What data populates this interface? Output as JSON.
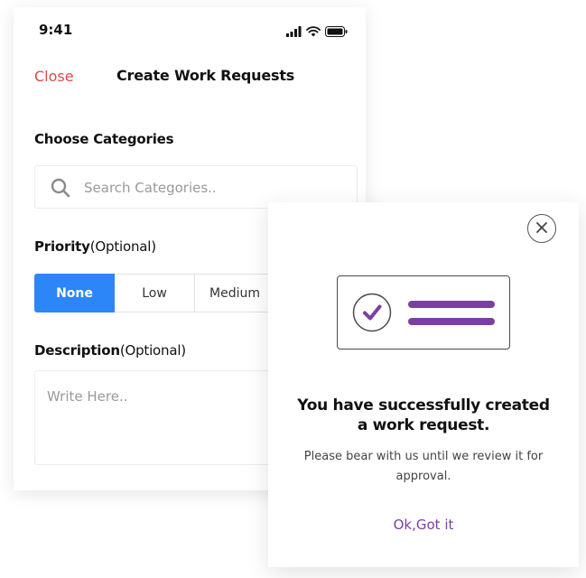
{
  "status_bar": {
    "time": "9:41",
    "icons": [
      "signal-icon",
      "wifi-icon",
      "battery-icon"
    ]
  },
  "nav": {
    "close_label": "Close",
    "title": "Create Work Requests"
  },
  "categories": {
    "title": "Choose Categories",
    "search_placeholder": "Search Categories.."
  },
  "priority": {
    "label": "Priority",
    "label_suffix": "(Optional)",
    "options": [
      "None",
      "Low",
      "Medium"
    ],
    "selected": "None"
  },
  "description": {
    "label": "Description",
    "label_suffix": "(Optional)",
    "placeholder": "Write Here.."
  },
  "modal": {
    "title_line1": "You have successfully created",
    "title_line2": "a work request.",
    "body_line1": "Please bear with us until we review it for",
    "body_line2": "approval.",
    "action_label": "Ok,Got it"
  },
  "colors": {
    "close_red": "#e04848",
    "primary_blue": "#2d86f8",
    "accent_purple": "#7b3fa0"
  }
}
